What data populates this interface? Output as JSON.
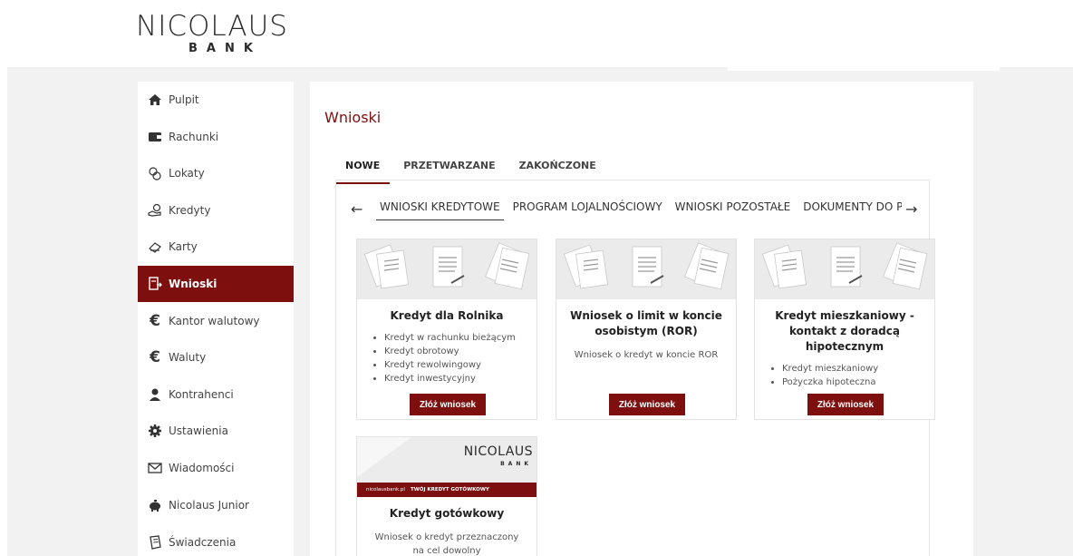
{
  "brand": {
    "name": "NICOLAUS",
    "sub": "BANK"
  },
  "sidebar": {
    "items": [
      {
        "label": "Pulpit",
        "icon": "home-icon"
      },
      {
        "label": "Rachunki",
        "icon": "wallet-icon"
      },
      {
        "label": "Lokaty",
        "icon": "coins-icon"
      },
      {
        "label": "Kredyty",
        "icon": "hand-coin-icon"
      },
      {
        "label": "Karty",
        "icon": "card-icon"
      },
      {
        "label": "Wnioski",
        "icon": "document-icon",
        "active": true
      },
      {
        "label": "Kantor walutowy",
        "icon": "euro-icon"
      },
      {
        "label": "Waluty",
        "icon": "euro-icon"
      },
      {
        "label": "Kontrahenci",
        "icon": "person-icon"
      },
      {
        "label": "Ustawienia",
        "icon": "gear-icon"
      },
      {
        "label": "Wiadomości",
        "icon": "mail-icon"
      },
      {
        "label": "Nicolaus Junior",
        "icon": "piggy-bank-icon"
      },
      {
        "label": "Świadczenia",
        "icon": "notebook-icon"
      }
    ]
  },
  "main": {
    "title": "Wnioski",
    "tabs": [
      "NOWE",
      "PRZETWARZANE",
      "ZAKOŃCZONE"
    ],
    "sub_tabs": [
      "WNIOSKI KREDYTOWE",
      "PROGRAM LOJALNOŚCIOWY",
      "WNIOSKI POZOSTAŁE",
      "DOKUMENTY DO P"
    ],
    "cards": [
      {
        "title": "Kredyt dla Rolnika",
        "items": [
          "Kredyt w rachunku bieżącym",
          "Kredyt obrotowy",
          "Kredyt rewolwingowy",
          "Kredyt inwestycyjny"
        ],
        "button": "Złóż wniosek"
      },
      {
        "title": "Wniosek o limit w koncie osobistym (ROR)",
        "desc": "Wniosek o kredyt w koncie ROR",
        "button": "Złóż wniosek"
      },
      {
        "title": "Kredyt mieszkaniowy -kontakt z doradcą hipotecznym",
        "items": [
          "Kredyt mieszkaniowy",
          "Pożyczka hipoteczna"
        ],
        "button": "Złóż wniosek"
      },
      {
        "title": "Kredyt gotówkowy",
        "desc": "Wniosek o kredyt przeznaczony na cel dowolny",
        "banner": {
          "logo": "NICOLAUS",
          "sub": "BANK",
          "site": "nicolausbank.pl",
          "slogan": "TWÓJ KREDYT GOTÓWKOWY"
        }
      }
    ]
  }
}
